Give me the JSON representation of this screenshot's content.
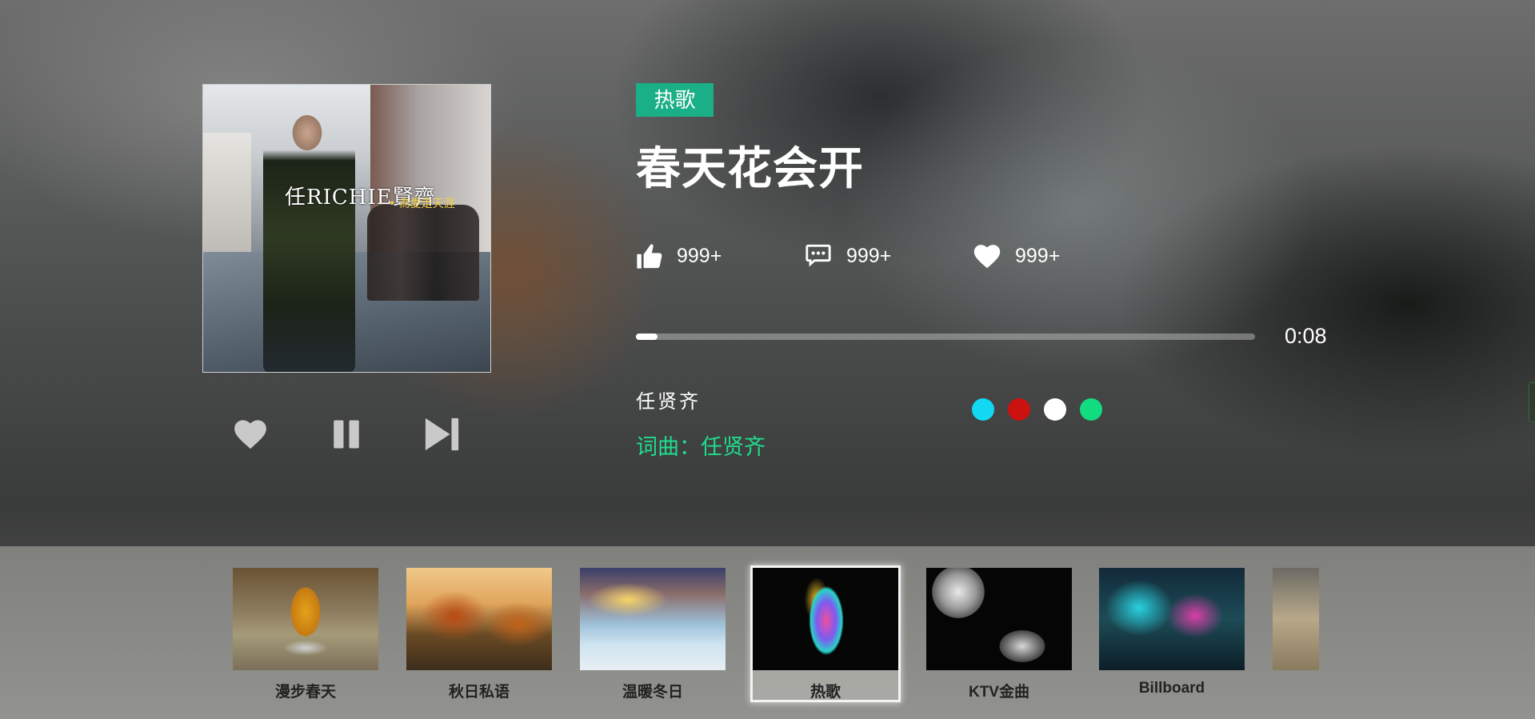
{
  "song": {
    "tag": "热歌",
    "title": "春天花会开",
    "artist": "任贤齐",
    "credits": "词曲：任贤齐",
    "cover_logo": "任RICHIE賢齊",
    "cover_subtitle": "• 為愛走天涯"
  },
  "stats": {
    "likes": "999+",
    "comments": "999+",
    "favorites": "999+"
  },
  "player": {
    "elapsed": "0:08",
    "progress_fraction": 0.035
  },
  "theme_swatches": [
    {
      "name": "cyan",
      "color": "#12d8f2"
    },
    {
      "name": "red",
      "color": "#cc1111"
    },
    {
      "name": "white",
      "color": "#ffffff"
    },
    {
      "name": "green",
      "color": "#12dc80"
    }
  ],
  "icons": {
    "like": "thumbs-up-icon",
    "comment": "comment-bubble-icon",
    "favorite": "heart-icon",
    "control_like": "heart-icon",
    "control_pause": "pause-icon",
    "control_next": "skip-next-icon"
  },
  "playlists": [
    {
      "label": "漫步春天",
      "active": false
    },
    {
      "label": "秋日私语",
      "active": false
    },
    {
      "label": "温暖冬日",
      "active": false
    },
    {
      "label": "热歌",
      "active": true
    },
    {
      "label": "KTV金曲",
      "active": false
    },
    {
      "label": "Billboard",
      "active": false
    }
  ],
  "colors": {
    "accent": "#1aaf86",
    "credits": "#1fdc8d"
  }
}
